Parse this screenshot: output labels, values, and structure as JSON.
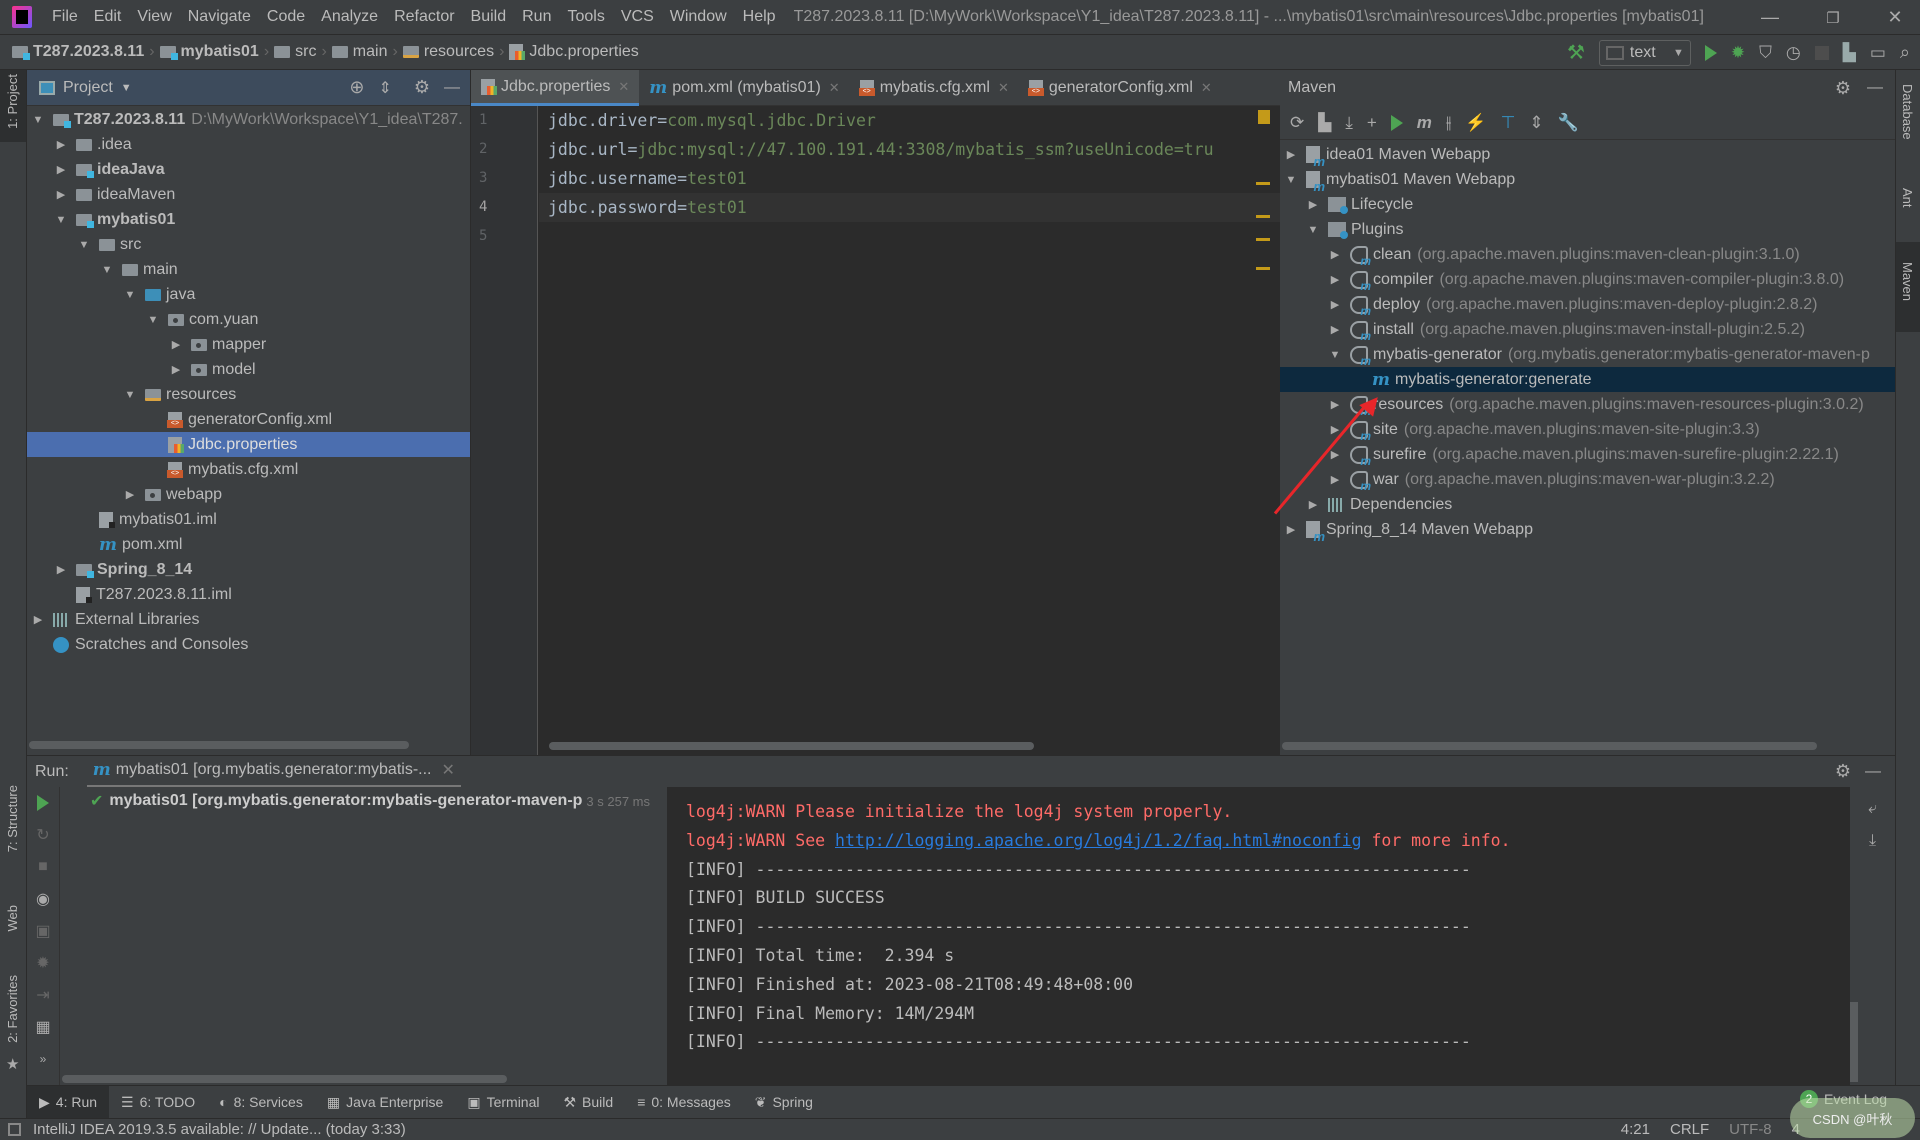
{
  "window": {
    "title": "T287.2023.8.11 [D:\\MyWork\\Workspace\\Y1_idea\\T287.2023.8.11] - ...\\mybatis01\\src\\main\\resources\\Jdbc.properties [mybatis01]",
    "menu": [
      "File",
      "Edit",
      "View",
      "Navigate",
      "Code",
      "Analyze",
      "Refactor",
      "Build",
      "Run",
      "Tools",
      "VCS",
      "Window",
      "Help"
    ],
    "controls": {
      "minimize": "—",
      "maximize": "❐",
      "close": "✕"
    }
  },
  "breadcrumb": [
    {
      "label": "T287.2023.8.11",
      "icon": "module-folder",
      "bold": true
    },
    {
      "label": "mybatis01",
      "icon": "module-folder",
      "bold": true
    },
    {
      "label": "src",
      "icon": "folder"
    },
    {
      "label": "main",
      "icon": "folder"
    },
    {
      "label": "resources",
      "icon": "resources-folder"
    },
    {
      "label": "Jdbc.properties",
      "icon": "properties-file"
    }
  ],
  "toolbar": {
    "run_config": "text"
  },
  "left_strip": {
    "project": "1: Project",
    "structure": "7: Structure",
    "web": "Web",
    "favorites": "2: Favorites"
  },
  "right_strip": {
    "database": "Database",
    "ant": "Ant",
    "maven": "Maven"
  },
  "project": {
    "title": "Project",
    "tree": [
      {
        "label": "T287.2023.8.11",
        "hint": "D:\\MyWork\\Workspace\\Y1_idea\\T287.",
        "depth": 0,
        "arrow": "down",
        "icon": "module",
        "bold": true
      },
      {
        "label": ".idea",
        "depth": 1,
        "arrow": "right",
        "icon": "folder"
      },
      {
        "label": "ideaJava",
        "depth": 1,
        "arrow": "right",
        "icon": "module",
        "bold": true
      },
      {
        "label": "ideaMaven",
        "depth": 1,
        "arrow": "right",
        "icon": "folder"
      },
      {
        "label": "mybatis01",
        "depth": 1,
        "arrow": "down",
        "icon": "module",
        "bold": true
      },
      {
        "label": "src",
        "depth": 2,
        "arrow": "down",
        "icon": "folder"
      },
      {
        "label": "main",
        "depth": 3,
        "arrow": "down",
        "icon": "folder"
      },
      {
        "label": "java",
        "depth": 4,
        "arrow": "down",
        "icon": "src"
      },
      {
        "label": "com.yuan",
        "depth": 5,
        "arrow": "down",
        "icon": "pkg"
      },
      {
        "label": "mapper",
        "depth": 6,
        "arrow": "right",
        "icon": "pkg"
      },
      {
        "label": "model",
        "depth": 6,
        "arrow": "right",
        "icon": "pkg"
      },
      {
        "label": "resources",
        "depth": 4,
        "arrow": "down",
        "icon": "res"
      },
      {
        "label": "generatorConfig.xml",
        "depth": 5,
        "arrow": "",
        "icon": "xml"
      },
      {
        "label": "Jdbc.properties",
        "depth": 5,
        "arrow": "",
        "icon": "props",
        "selected": true
      },
      {
        "label": "mybatis.cfg.xml",
        "depth": 5,
        "arrow": "",
        "icon": "xml"
      },
      {
        "label": "webapp",
        "depth": 4,
        "arrow": "right",
        "icon": "pkg"
      },
      {
        "label": "mybatis01.iml",
        "depth": 2,
        "arrow": "",
        "icon": "iml"
      },
      {
        "label": "pom.xml",
        "depth": 2,
        "arrow": "",
        "icon": "maven"
      },
      {
        "label": "Spring_8_14",
        "depth": 1,
        "arrow": "right",
        "icon": "module",
        "bold": true
      },
      {
        "label": "T287.2023.8.11.iml",
        "depth": 1,
        "arrow": "",
        "icon": "iml"
      },
      {
        "label": "External Libraries",
        "depth": 0,
        "arrow": "right",
        "icon": "lib"
      },
      {
        "label": "Scratches and Consoles",
        "depth": 0,
        "arrow": "",
        "icon": "scratch"
      }
    ]
  },
  "editor": {
    "tabs": [
      {
        "label": "Jdbc.properties",
        "icon": "props",
        "active": true
      },
      {
        "label": "pom.xml (mybatis01)",
        "icon": "maven"
      },
      {
        "label": "mybatis.cfg.xml",
        "icon": "xml"
      },
      {
        "label": "generatorConfig.xml",
        "icon": "xml"
      }
    ],
    "lines": [
      {
        "num": "1",
        "key": "jdbc.driver=",
        "value": "com.mysql.jdbc.Driver"
      },
      {
        "num": "2",
        "key": "jdbc.url=",
        "value": "jdbc:mysql://47.100.191.44:3308/mybatis_ssm?useUnicode=tru"
      },
      {
        "num": "3",
        "key": "jdbc.username=",
        "value": "test01"
      },
      {
        "num": "4",
        "key": "jdbc.password=",
        "value": "test01",
        "current": true
      },
      {
        "num": "5",
        "key": "",
        "value": ""
      }
    ]
  },
  "maven": {
    "title": "Maven",
    "tree": [
      {
        "label": "idea01 Maven Webapp",
        "depth": 0,
        "arrow": "right",
        "icon": "project"
      },
      {
        "label": "mybatis01 Maven Webapp",
        "depth": 0,
        "arrow": "down",
        "icon": "project"
      },
      {
        "label": "Lifecycle",
        "depth": 1,
        "arrow": "right",
        "icon": "mfolder"
      },
      {
        "label": "Plugins",
        "depth": 1,
        "arrow": "down",
        "icon": "mfolder"
      },
      {
        "label": "clean",
        "detail": "(org.apache.maven.plugins:maven-clean-plugin:3.1.0)",
        "depth": 2,
        "arrow": "right",
        "icon": "plugin"
      },
      {
        "label": "compiler",
        "detail": "(org.apache.maven.plugins:maven-compiler-plugin:3.8.0)",
        "depth": 2,
        "arrow": "right",
        "icon": "plugin"
      },
      {
        "label": "deploy",
        "detail": "(org.apache.maven.plugins:maven-deploy-plugin:2.8.2)",
        "depth": 2,
        "arrow": "right",
        "icon": "plugin"
      },
      {
        "label": "install",
        "detail": "(org.apache.maven.plugins:maven-install-plugin:2.5.2)",
        "depth": 2,
        "arrow": "right",
        "icon": "plugin"
      },
      {
        "label": "mybatis-generator",
        "detail": "(org.mybatis.generator:mybatis-generator-maven-p",
        "depth": 2,
        "arrow": "down",
        "icon": "plugin"
      },
      {
        "label": "mybatis-generator:generate",
        "depth": 3,
        "arrow": "",
        "icon": "goal",
        "selected": true
      },
      {
        "label": "resources",
        "detail": "(org.apache.maven.plugins:maven-resources-plugin:3.0.2)",
        "depth": 2,
        "arrow": "right",
        "icon": "plugin"
      },
      {
        "label": "site",
        "detail": "(org.apache.maven.plugins:maven-site-plugin:3.3)",
        "depth": 2,
        "arrow": "right",
        "icon": "plugin"
      },
      {
        "label": "surefire",
        "detail": "(org.apache.maven.plugins:maven-surefire-plugin:2.22.1)",
        "depth": 2,
        "arrow": "right",
        "icon": "plugin"
      },
      {
        "label": "war",
        "detail": "(org.apache.maven.plugins:maven-war-plugin:3.2.2)",
        "depth": 2,
        "arrow": "right",
        "icon": "plugin"
      },
      {
        "label": "Dependencies",
        "depth": 1,
        "arrow": "right",
        "icon": "deps"
      },
      {
        "label": "Spring_8_14 Maven Webapp",
        "depth": 0,
        "arrow": "right",
        "icon": "project"
      }
    ]
  },
  "run": {
    "label": "Run:",
    "tab": "mybatis01 [org.mybatis.generator:mybatis-...",
    "item": "mybatis01 [org.mybatis.generator:mybatis-generator-maven-p",
    "duration": "3 s 257 ms",
    "console": [
      {
        "type": "warn",
        "text": "log4j:WARN Please initialize the log4j system properly."
      },
      {
        "type": "warn",
        "text": "log4j:WARN See ",
        "link": "http://logging.apache.org/log4j/1.2/faq.html#noconfig",
        "after": " for more info."
      },
      {
        "type": "info",
        "text": "[INFO] ------------------------------------------------------------------------"
      },
      {
        "type": "info",
        "text": "[INFO] BUILD SUCCESS"
      },
      {
        "type": "info",
        "text": "[INFO] ------------------------------------------------------------------------"
      },
      {
        "type": "info",
        "text": "[INFO] Total time:  2.394 s"
      },
      {
        "type": "info",
        "text": "[INFO] Finished at: 2023-08-21T08:49:48+08:00"
      },
      {
        "type": "info",
        "text": "[INFO] Final Memory: 14M/294M"
      },
      {
        "type": "info",
        "text": "[INFO] ------------------------------------------------------------------------"
      }
    ]
  },
  "tool_windows": [
    {
      "label": "4: Run",
      "icon": "▶",
      "active": true
    },
    {
      "label": "6: TODO",
      "icon": "☰"
    },
    {
      "label": "8: Services",
      "icon": "◐"
    },
    {
      "label": "Java Enterprise",
      "icon": "▦"
    },
    {
      "label": "Terminal",
      "icon": "▣"
    },
    {
      "label": "Build",
      "icon": "⚒"
    },
    {
      "label": "0: Messages",
      "icon": "≡"
    },
    {
      "label": "Spring",
      "icon": "❦"
    }
  ],
  "event_log": {
    "label": "Event Log",
    "count": "2"
  },
  "status": {
    "message": "IntelliJ IDEA 2019.3.5 available: // Update... (today 3:33)",
    "position": "4:21",
    "line_sep": "CRLF",
    "encoding": "UTF-8",
    "indent": "4"
  },
  "watermark": "CSDN @叶秋"
}
